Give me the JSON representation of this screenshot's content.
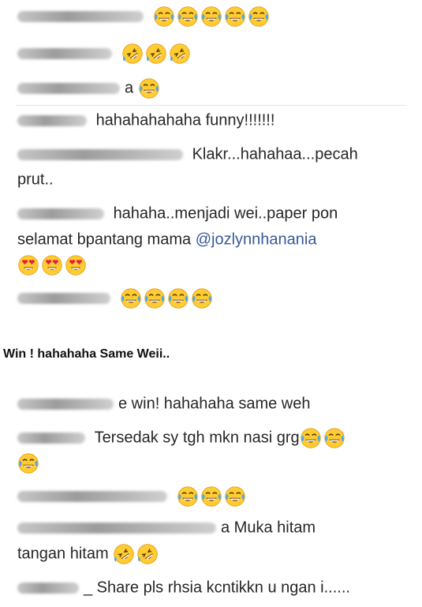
{
  "top_comments": [
    {
      "text": "",
      "emoji": [
        "tears-of-joy",
        "tears-of-joy",
        "tears-of-joy",
        "tears-of-joy",
        "tears-of-joy"
      ]
    },
    {
      "text": "",
      "emoji": [
        "rofl",
        "rofl",
        "rofl"
      ]
    },
    {
      "text": "a",
      "emoji": [
        "tears-of-joy"
      ]
    },
    {
      "text": "hahahahahaha funny!!!!!!!",
      "emoji": []
    },
    {
      "text": "Klakr...hahahaa...pecah",
      "text2": "prut..",
      "emoji": []
    },
    {
      "text": "hahaha..menjadi wei..paper pon",
      "text2": "selamat bpantang mama",
      "mention": "@jozlynnhanania",
      "emoji": [
        "heart-eyes",
        "heart-eyes",
        "heart-eyes"
      ]
    },
    {
      "text": "",
      "emoji": [
        "tears-of-joy",
        "tears-of-joy",
        "tears-of-joy",
        "tears-of-joy"
      ]
    }
  ],
  "heading": "Win ! hahahaha Same Weii..",
  "bottom_comments": [
    {
      "text": "e win! hahahaha same weh",
      "emoji": []
    },
    {
      "text": "Tersedak sy tgh mkn nasi grg",
      "emoji": [
        "tears-of-joy",
        "tears-of-joy",
        "tears-of-joy"
      ]
    },
    {
      "text": "",
      "emoji": [
        "tears-of-joy",
        "tears-of-joy",
        "tears-of-joy"
      ]
    },
    {
      "text": "a Muka hitam",
      "text2": "tangan hitam",
      "emoji": [
        "rofl",
        "rofl"
      ]
    },
    {
      "text": "_ Share pls rhsia kcntikkn u ngan i......",
      "emoji": []
    }
  ]
}
